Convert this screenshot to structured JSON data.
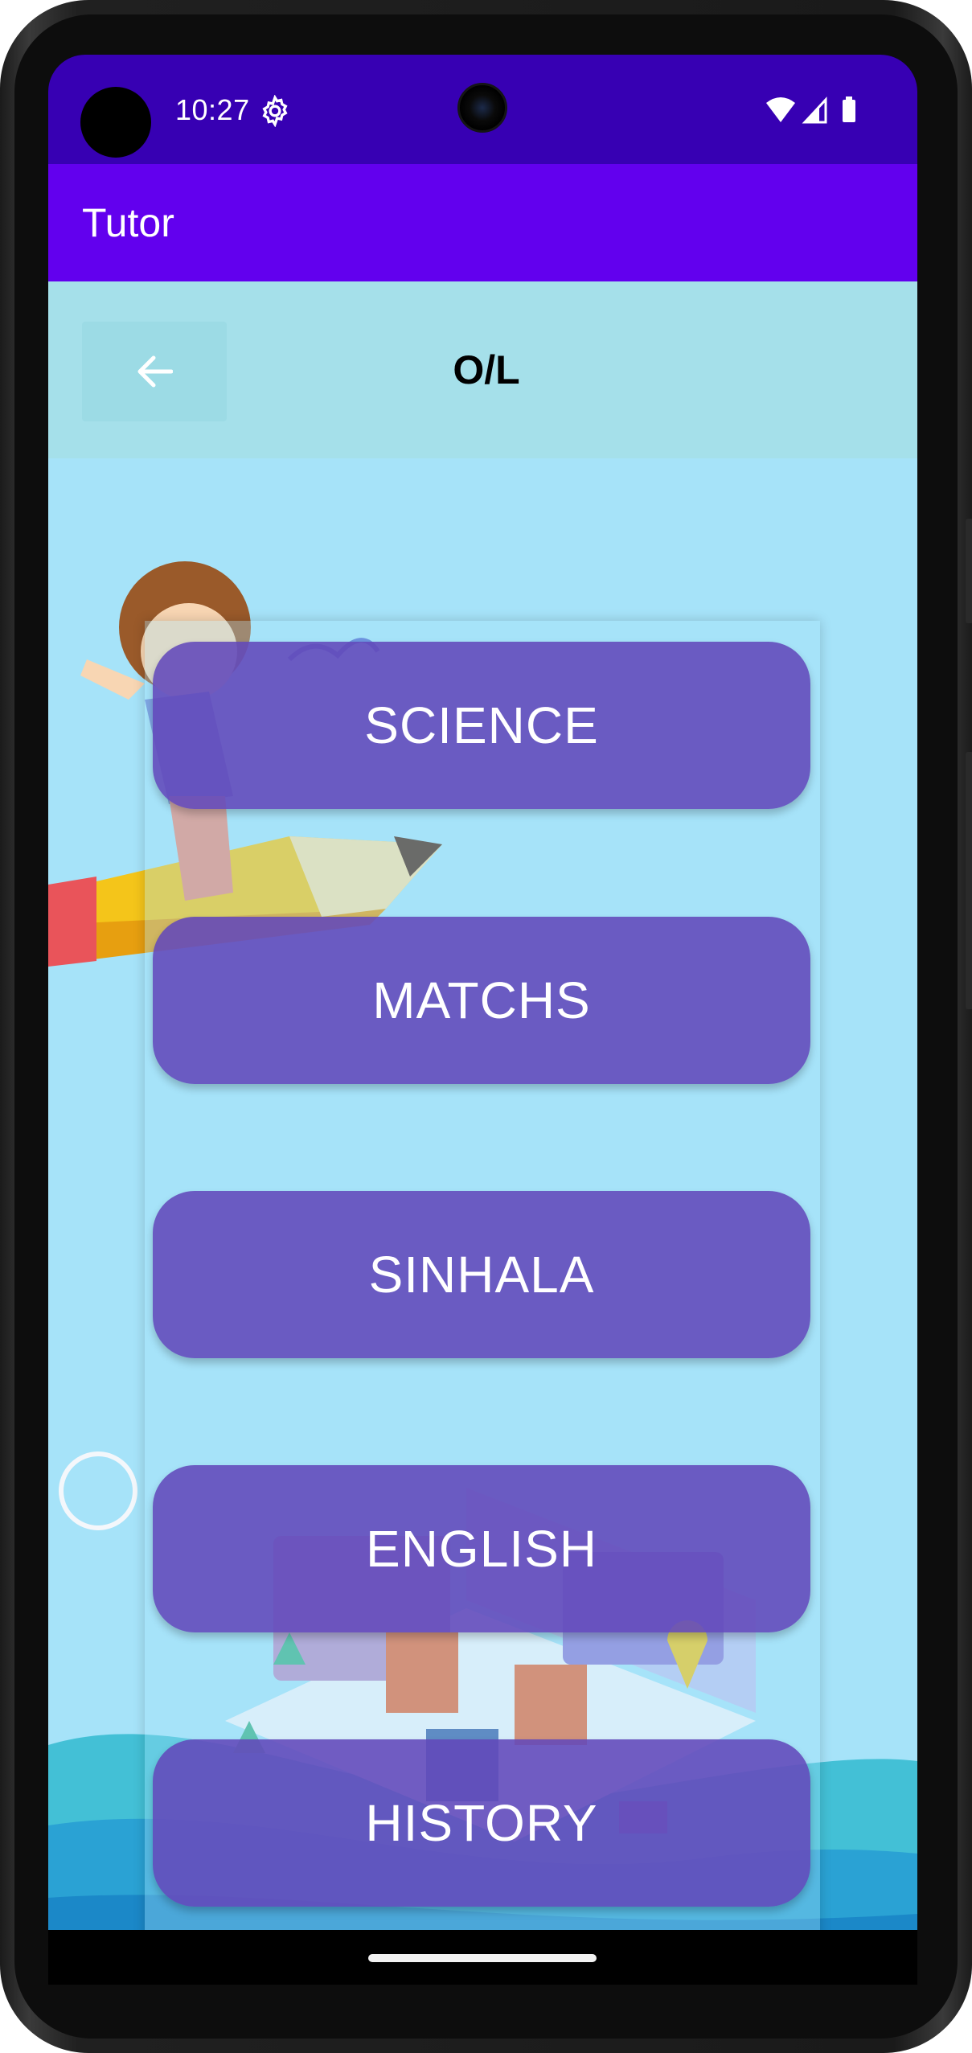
{
  "status_bar": {
    "time": "10:27",
    "icons": [
      "settings-gear-icon",
      "wifi-icon",
      "cellular-signal-icon",
      "battery-icon"
    ]
  },
  "app_bar": {
    "title": "Tutor"
  },
  "sub_header": {
    "back_icon": "arrow-left-icon",
    "title": "O/L"
  },
  "subjects": [
    {
      "label": "SCIENCE"
    },
    {
      "label": "MATCHS"
    },
    {
      "label": "SINHALA"
    },
    {
      "label": "ENGLISH"
    },
    {
      "label": "HISTORY"
    }
  ],
  "colors": {
    "status_bar": "#3700b3",
    "app_bar": "#6200ee",
    "content_bg": "#a6e3f9",
    "subject_button": "#6248ba"
  }
}
